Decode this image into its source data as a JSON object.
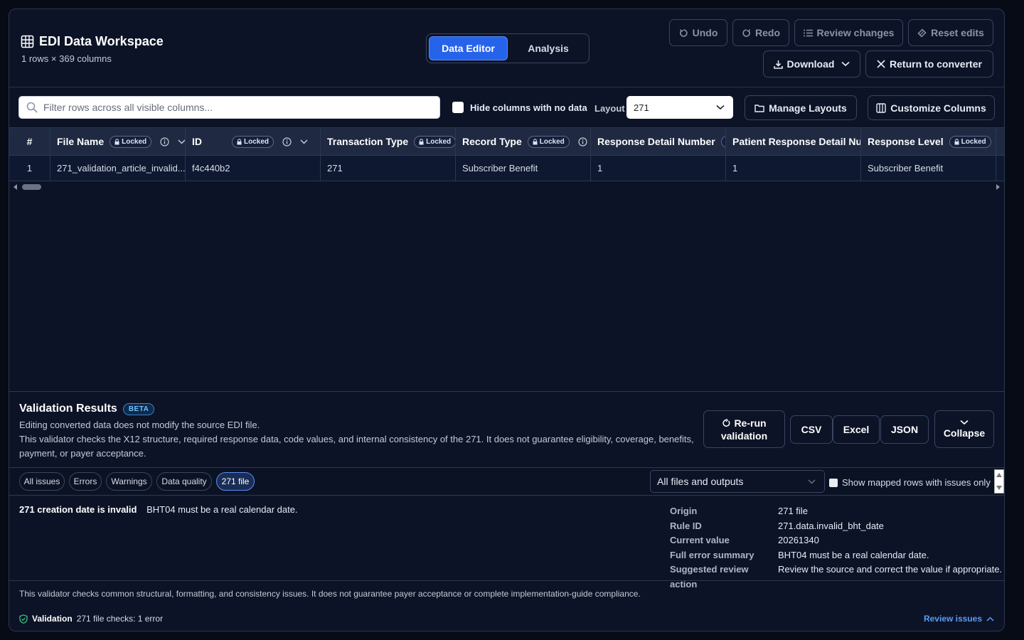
{
  "header": {
    "title": "EDI Data Workspace",
    "subtitle": "1 rows × 369 columns",
    "tabs": [
      "Data Editor",
      "Analysis"
    ],
    "undo": "Undo",
    "redo": "Redo",
    "review_changes": "Review changes",
    "reset_edits": "Reset edits",
    "download": "Download",
    "return": "Return to converter"
  },
  "toolbar": {
    "filter_placeholder": "Filter rows across all visible columns...",
    "hide_empty": "Hide columns with no data",
    "layout_label": "Layout",
    "layout_value": "271",
    "manage_layouts": "Manage Layouts",
    "customize_columns": "Customize Columns"
  },
  "grid": {
    "row_header": "#",
    "locked": "Locked",
    "columns": [
      "File Name",
      "ID",
      "Transaction Type",
      "Record Type",
      "Response Detail Number",
      "Patient Response Detail Numb",
      "Response Level"
    ],
    "row": {
      "num": "1",
      "cells": [
        "271_validation_article_invalid...",
        "f4c440b2",
        "271",
        "Subscriber Benefit",
        "1",
        "1",
        "Subscriber Benefit"
      ]
    }
  },
  "validation": {
    "title": "Validation Results",
    "badge": "BETA",
    "note1": "Editing converted data does not modify the source EDI file.",
    "note2": "This validator checks the X12 structure, required response data, code values, and internal consistency of the 271. It does not guarantee eligibility, coverage, benefits,",
    "note3": "payment, or payer acceptance.",
    "rerun_l1": "Re-run",
    "rerun_l2": "validation",
    "csv": "CSV",
    "excel": "Excel",
    "json": "JSON",
    "collapse": "Collapse",
    "filters": [
      "All issues",
      "Errors",
      "Warnings",
      "Data quality",
      "271 file"
    ],
    "scope": "All files and outputs",
    "mapped_only": "Show mapped rows with issues only",
    "issue_title": "271 creation date is invalid",
    "issue_text": "BHT04 must be a real calendar date.",
    "details": [
      {
        "k": "Origin",
        "v": "271 file"
      },
      {
        "k": "Rule ID",
        "v": "271.data.invalid_bht_date"
      },
      {
        "k": "Current value",
        "v": "20261340"
      },
      {
        "k": "Full error summary",
        "v": "BHT04 must be a real calendar date."
      },
      {
        "k": "Suggested review action",
        "v": "Review the source and correct the value if appropriate."
      }
    ],
    "footer_note": "This validator checks common structural, formatting, and consistency issues. It does not guarantee payer acceptance or complete implementation-guide compliance.",
    "status_label": "Validation",
    "status_text": "271 file checks: 1 error",
    "review_issues": "Review issues"
  },
  "colors": {
    "accent": "#2563eb",
    "link": "#5b9cf5",
    "background": "#0c1326"
  }
}
